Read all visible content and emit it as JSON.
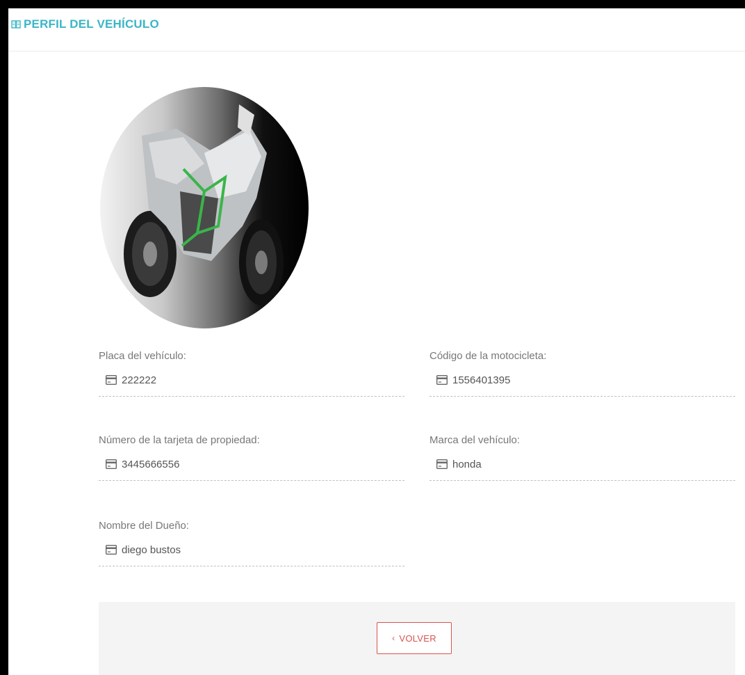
{
  "header": {
    "title": "PERFIL DEL VEHÍCULO",
    "icon": "book-icon"
  },
  "colors": {
    "accent": "#39b6c6",
    "danger": "#d9534f"
  },
  "fields": [
    {
      "label": "Placa del vehículo:",
      "value": "222222",
      "icon": "card-icon"
    },
    {
      "label": "Código de la motocicleta:",
      "value": "1556401395",
      "icon": "card-icon"
    },
    {
      "label": "Número de la tarjeta de propiedad:",
      "value": "3445666556",
      "icon": "card-icon"
    },
    {
      "label": "Marca del vehículo:",
      "value": "honda",
      "icon": "card-icon"
    },
    {
      "label": "Nombre del Dueño:",
      "value": "diego bustos",
      "icon": "card-icon"
    }
  ],
  "footer": {
    "back_label": "VOLVER",
    "back_icon": "chevron-left-icon"
  }
}
